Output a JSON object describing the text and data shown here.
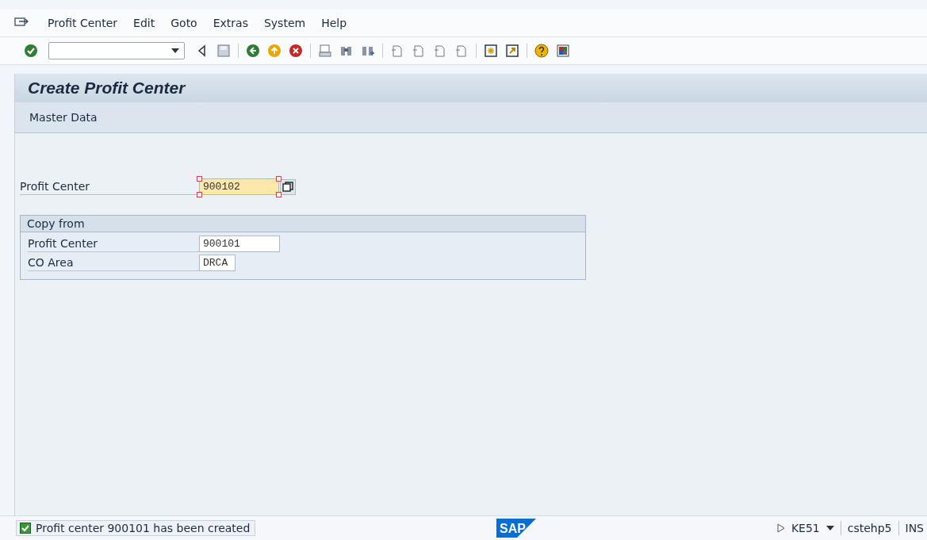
{
  "menu": [
    {
      "label": "Profit Center"
    },
    {
      "label": "Edit"
    },
    {
      "label": "Goto"
    },
    {
      "label": "Extras"
    },
    {
      "label": "System"
    },
    {
      "label": "Help"
    }
  ],
  "title": "Create Profit Center",
  "subheader": {
    "label": "Master Data"
  },
  "main_field": {
    "label": "Profit Center",
    "value": "900102",
    "focused": true
  },
  "copy_from": {
    "title": "Copy from",
    "fields": [
      {
        "label": "Profit Center",
        "value": "900101",
        "focused": false
      },
      {
        "label": "CO Area",
        "value": "DRCA",
        "focused": false
      }
    ]
  },
  "status_bar": {
    "logo": "SAP",
    "message": {
      "kind": "success",
      "text": "Profit center 900101 has been created"
    },
    "transaction": "KE51",
    "server": "cstehp5",
    "mode": "INS"
  }
}
